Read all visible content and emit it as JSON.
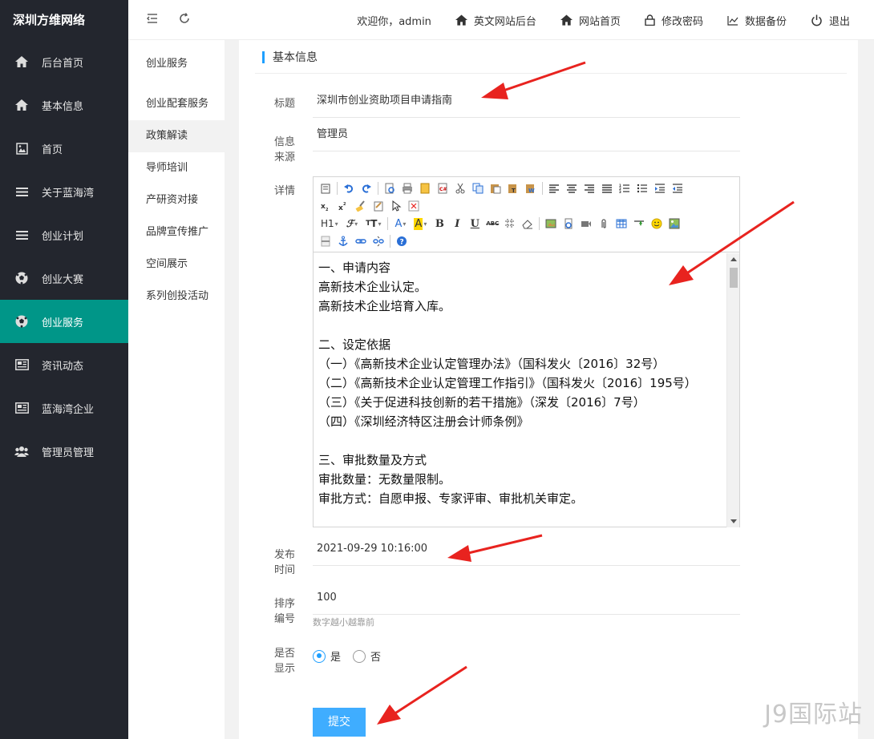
{
  "brand": "深圳方维网络",
  "sidebar": {
    "items": [
      {
        "label": "后台首页",
        "icon": "home-icon"
      },
      {
        "label": "基本信息",
        "icon": "home-icon"
      },
      {
        "label": "首页",
        "icon": "image-icon"
      },
      {
        "label": "关于蓝海湾",
        "icon": "list-icon"
      },
      {
        "label": "创业计划",
        "icon": "list-icon"
      },
      {
        "label": "创业大赛",
        "icon": "soccer-icon"
      },
      {
        "label": "创业服务",
        "icon": "soccer-icon",
        "active": true
      },
      {
        "label": "资讯动态",
        "icon": "news-icon"
      },
      {
        "label": "蓝海湾企业",
        "icon": "news-icon"
      },
      {
        "label": "管理员管理",
        "icon": "users-icon"
      }
    ]
  },
  "topbar": {
    "welcome": "欢迎你，admin",
    "links": [
      {
        "label": "英文网站后台",
        "icon": "home-icon"
      },
      {
        "label": "网站首页",
        "icon": "home-icon"
      },
      {
        "label": "修改密码",
        "icon": "lock-icon"
      },
      {
        "label": "数据备份",
        "icon": "chart-icon"
      },
      {
        "label": "退出",
        "icon": "power-icon"
      }
    ]
  },
  "submenu": {
    "items": [
      {
        "label": "创业服务"
      },
      {
        "label": "创业配套服务"
      },
      {
        "label": "政策解读",
        "active": true
      },
      {
        "label": "导师培训"
      },
      {
        "label": "产研资对接"
      },
      {
        "label": "品牌宣传推广"
      },
      {
        "label": "空间展示"
      },
      {
        "label": "系列创投活动"
      }
    ]
  },
  "form": {
    "section_title": "基本信息",
    "title_label": "标题",
    "title_value": "深圳市创业资助项目申请指南",
    "source_label": "信息来源",
    "source_value": "管理员",
    "detail_label": "详情",
    "content_lines": [
      "一、申请内容",
      "高新技术企业认定。",
      "高新技术企业培育入库。",
      "",
      "二、设定依据",
      "（一）《高新技术企业认定管理办法》（国科发火〔2016〕32号）",
      "（二）《高新技术企业认定管理工作指引》（国科发火〔2016〕195号）",
      "（三）《关于促进科技创新的若干措施》（深发〔2016〕7号）",
      "（四）《深圳经济特区注册会计师条例》",
      "",
      "三、审批数量及方式",
      "审批数量：无数量限制。",
      "审批方式：自愿申报、专家评审、审批机关审定。"
    ],
    "publish_label": "发布时间",
    "publish_value": "2021-09-29 10:16:00",
    "sort_label": "排序编号",
    "sort_value": "100",
    "sort_hint": "数字越小越靠前",
    "show_label": "是否显示",
    "show_yes": "是",
    "show_no": "否",
    "submit_label": "提交"
  },
  "watermark": "J9国际站",
  "colors": {
    "sidebar_bg": "#23262e",
    "active_green": "#009688",
    "accent_blue": "#1e9fff",
    "arrow_red": "#e8231f"
  }
}
